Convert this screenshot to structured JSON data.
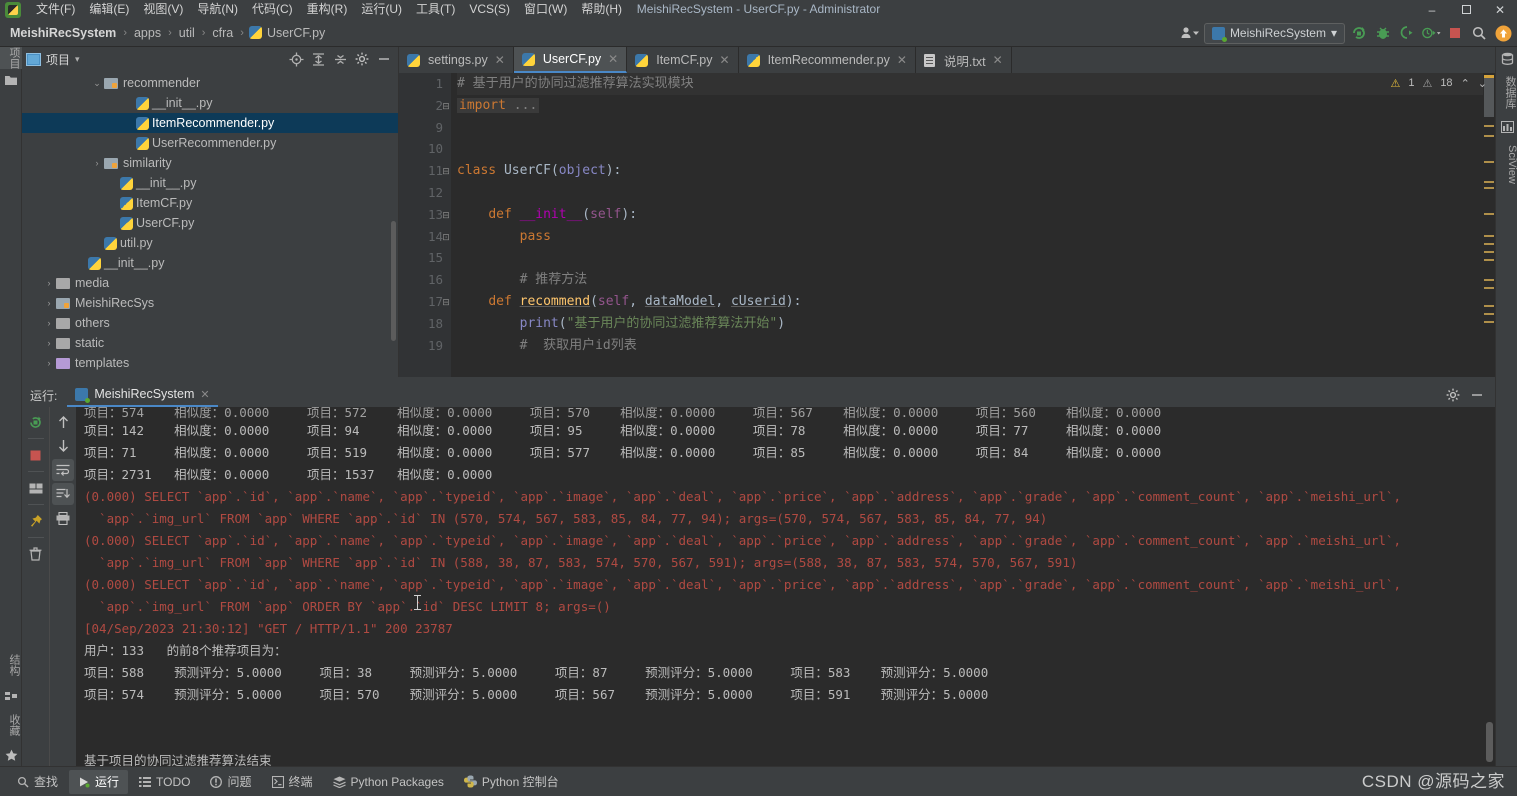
{
  "window": {
    "title": "MeishiRecSystem - UserCF.py - Administrator",
    "minimize": "–",
    "maximize": "❐",
    "close": "✕"
  },
  "menubar": {
    "items": [
      {
        "label": "文件(F)",
        "name": "menu-file"
      },
      {
        "label": "编辑(E)",
        "name": "menu-edit"
      },
      {
        "label": "视图(V)",
        "name": "menu-view"
      },
      {
        "label": "导航(N)",
        "name": "menu-navigate"
      },
      {
        "label": "代码(C)",
        "name": "menu-code"
      },
      {
        "label": "重构(R)",
        "name": "menu-refactor"
      },
      {
        "label": "运行(U)",
        "name": "menu-run"
      },
      {
        "label": "工具(T)",
        "name": "menu-tools"
      },
      {
        "label": "VCS(S)",
        "name": "menu-vcs"
      },
      {
        "label": "窗口(W)",
        "name": "menu-window"
      },
      {
        "label": "帮助(H)",
        "name": "menu-help"
      }
    ]
  },
  "breadcrumb": {
    "items": [
      "MeishiRecSystem",
      "apps",
      "util",
      "cfra",
      "UserCF.py"
    ],
    "separator": "›"
  },
  "toolbar_right": {
    "run_config": "MeishiRecSystem",
    "dropdown_caret": "▾"
  },
  "left_rail": {
    "project_label": "项目",
    "structure_label": "结构",
    "favorites_label": "收藏"
  },
  "right_rail": {
    "database_label": "数据库",
    "sciview_label": "SciView"
  },
  "project_pane": {
    "title": "项目",
    "caret": "▾",
    "tree": [
      {
        "indent": 4,
        "arrow": "⌄",
        "icon": "folder-src",
        "label": "recommender",
        "selected": false
      },
      {
        "indent": 6,
        "arrow": "",
        "icon": "python",
        "label": "__init__.py",
        "selected": false
      },
      {
        "indent": 6,
        "arrow": "",
        "icon": "python",
        "label": "ItemRecommender.py",
        "selected": true
      },
      {
        "indent": 6,
        "arrow": "",
        "icon": "python",
        "label": "UserRecommender.py",
        "selected": false
      },
      {
        "indent": 4,
        "arrow": "›",
        "icon": "folder-src",
        "label": "similarity",
        "selected": false
      },
      {
        "indent": 5,
        "arrow": "",
        "icon": "python",
        "label": "__init__.py",
        "selected": false
      },
      {
        "indent": 5,
        "arrow": "",
        "icon": "python",
        "label": "ItemCF.py",
        "selected": false
      },
      {
        "indent": 5,
        "arrow": "",
        "icon": "python",
        "label": "UserCF.py",
        "selected": false
      },
      {
        "indent": 4,
        "arrow": "",
        "icon": "python",
        "label": "util.py",
        "selected": false
      },
      {
        "indent": 3,
        "arrow": "",
        "icon": "python",
        "label": "__init__.py",
        "selected": false
      },
      {
        "indent": 1,
        "arrow": "›",
        "icon": "folder",
        "label": "media",
        "selected": false
      },
      {
        "indent": 1,
        "arrow": "›",
        "icon": "folder-src",
        "label": "MeishiRecSys",
        "selected": false
      },
      {
        "indent": 1,
        "arrow": "›",
        "icon": "folder",
        "label": "others",
        "selected": false
      },
      {
        "indent": 1,
        "arrow": "›",
        "icon": "folder",
        "label": "static",
        "selected": false
      },
      {
        "indent": 1,
        "arrow": "›",
        "icon": "folder-purple",
        "label": "templates",
        "selected": false
      }
    ]
  },
  "editor": {
    "tabs": [
      {
        "label": "settings.py",
        "icon": "python",
        "active": false
      },
      {
        "label": "UserCF.py",
        "icon": "python",
        "active": true
      },
      {
        "label": "ItemCF.py",
        "icon": "python",
        "active": false
      },
      {
        "label": "ItemRecommender.py",
        "icon": "python",
        "active": false
      },
      {
        "label": "说明.txt",
        "icon": "text",
        "active": false
      }
    ],
    "close_glyph": "✕",
    "inspections": {
      "warning_count": "1",
      "weak_warning_count": "18",
      "up_glyph": "⌃",
      "down_glyph": "⌄"
    },
    "lines": [
      {
        "num": "1",
        "fold": "",
        "highlight": true
      },
      {
        "num": "2",
        "fold": "⊟",
        "highlight": false
      },
      {
        "num": "9",
        "fold": "",
        "highlight": false
      },
      {
        "num": "10",
        "fold": "",
        "highlight": false
      },
      {
        "num": "11",
        "fold": "⊟",
        "highlight": false
      },
      {
        "num": "12",
        "fold": "",
        "highlight": false
      },
      {
        "num": "13",
        "fold": "⊟",
        "highlight": false
      },
      {
        "num": "14",
        "fold": "⊡",
        "highlight": false
      },
      {
        "num": "15",
        "fold": "",
        "highlight": false
      },
      {
        "num": "16",
        "fold": "",
        "highlight": false
      },
      {
        "num": "17",
        "fold": "⊟",
        "highlight": false
      },
      {
        "num": "18",
        "fold": "",
        "highlight": false
      },
      {
        "num": "19",
        "fold": "",
        "highlight": false
      }
    ],
    "code_text": [
      "# 基于用户的协同过滤推荐算法实现模块",
      "import ...",
      "",
      "",
      "class UserCF(object):",
      "",
      "    def __init__(self):",
      "        pass",
      "",
      "    # 推荐方法",
      "    def recommend(self, dataModel, cUserid):",
      "        print(\"基于用户的协同过滤推荐算法开始\")",
      "        # 获取用户id列表"
    ]
  },
  "run_pane": {
    "label": "运行:",
    "tab_label": "MeishiRecSystem",
    "close_glyph": "✕",
    "console_lines": [
      {
        "kind": "clip",
        "text": "项目：574    相似度：0.0000     项目：572    相似度：0.0000     项目：570    相似度：0.0000     项目：567    相似度：0.0000     项目：560    相似度：0.0000"
      },
      {
        "kind": "plain",
        "text": "项目：142    相似度：0.0000     项目：94     相似度：0.0000     项目：95     相似度：0.0000     项目：78     相似度：0.0000     项目：77     相似度：0.0000"
      },
      {
        "kind": "plain",
        "text": "项目：71     相似度：0.0000     项目：519    相似度：0.0000     项目：577    相似度：0.0000     项目：85     相似度：0.0000     项目：84     相似度：0.0000"
      },
      {
        "kind": "plain",
        "text": "项目：2731   相似度：0.0000     项目：1537   相似度：0.0000"
      },
      {
        "kind": "sql",
        "text": "(0.000) SELECT `app`.`id`, `app`.`name`, `app`.`typeid`, `app`.`image`, `app`.`deal`, `app`.`price`, `app`.`address`, `app`.`grade`, `app`.`comment_count`, `app`.`meishi_url`,"
      },
      {
        "kind": "sql",
        "text": "  `app`.`img_url` FROM `app` WHERE `app`.`id` IN (570, 574, 567, 583, 85, 84, 77, 94); args=(570, 574, 567, 583, 85, 84, 77, 94)"
      },
      {
        "kind": "sql",
        "text": "(0.000) SELECT `app`.`id`, `app`.`name`, `app`.`typeid`, `app`.`image`, `app`.`deal`, `app`.`price`, `app`.`address`, `app`.`grade`, `app`.`comment_count`, `app`.`meishi_url`,"
      },
      {
        "kind": "sql",
        "text": "  `app`.`img_url` FROM `app` WHERE `app`.`id` IN (588, 38, 87, 583, 574, 570, 567, 591); args=(588, 38, 87, 583, 574, 570, 567, 591)"
      },
      {
        "kind": "sql",
        "text": "(0.000) SELECT `app`.`id`, `app`.`name`, `app`.`typeid`, `app`.`image`, `app`.`deal`, `app`.`price`, `app`.`address`, `app`.`grade`, `app`.`comment_count`, `app`.`meishi_url`,"
      },
      {
        "kind": "sql",
        "text": "  `app`.`img_url` FROM `app` ORDER BY `app`.`id` DESC LIMIT 8; args=()"
      },
      {
        "kind": "sql",
        "text": "[04/Sep/2023 21:30:12] \"GET / HTTP/1.1\" 200 23787"
      },
      {
        "kind": "plain",
        "text": "用户：133   的前8个推荐项目为："
      },
      {
        "kind": "plain",
        "text": "项目：588    预测评分：5.0000     项目：38     预测评分：5.0000     项目：87     预测评分：5.0000     项目：583    预测评分：5.0000"
      },
      {
        "kind": "plain",
        "text": "项目：574    预测评分：5.0000     项目：570    预测评分：5.0000     项目：567    预测评分：5.0000     项目：591    预测评分：5.0000"
      },
      {
        "kind": "plain",
        "text": ""
      },
      {
        "kind": "plain",
        "text": ""
      },
      {
        "kind": "plain",
        "text": "基于项目的协同过滤推荐算法结束"
      }
    ]
  },
  "statusbar": {
    "items": [
      {
        "label": "查找",
        "icon": "search-icon",
        "active": false
      },
      {
        "label": "运行",
        "icon": "run-icon",
        "active": true
      },
      {
        "label": "TODO",
        "icon": "todo-icon",
        "active": false
      },
      {
        "label": "问题",
        "icon": "problems-icon",
        "active": false
      },
      {
        "label": "终端",
        "icon": "terminal-icon",
        "active": false
      },
      {
        "label": "Python Packages",
        "icon": "packages-icon",
        "active": false
      },
      {
        "label": "Python 控制台",
        "icon": "python-console-icon",
        "active": false
      }
    ]
  },
  "watermark": "CSDN @源码之家",
  "colors": {
    "accent_blue": "#4a88c7",
    "selection_blue": "#0d3a58",
    "sql_red": "#b04a42",
    "panel_bg": "#3c3f41",
    "editor_bg": "#2b2b2b",
    "warning_yellow": "#e8bf3b",
    "run_green": "#499c54"
  }
}
